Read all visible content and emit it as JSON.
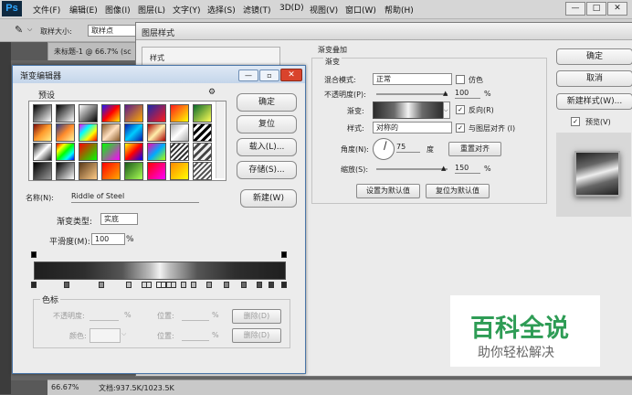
{
  "app": {
    "logo": "Ps",
    "menus": [
      "文件(F)",
      "编辑(E)",
      "图像(I)",
      "图层(L)",
      "文字(Y)",
      "选择(S)",
      "滤镜(T)",
      "3D(D)",
      "视图(V)",
      "窗口(W)",
      "帮助(H)"
    ],
    "window_controls": [
      "—",
      "□",
      "✕"
    ]
  },
  "options_bar": {
    "sample_size_label": "取样大小:",
    "sample_size_value": "取样点"
  },
  "document": {
    "tab_title": "未标题-1 @ 66.7% (sc",
    "zoom": "66.67%",
    "doc_info": "文档:937.5K/1023.5K"
  },
  "layer_style": {
    "title": "图层样式",
    "style_section": "样式",
    "group_title": "渐变叠加",
    "subgroup_title": "渐变",
    "blend_mode_label": "混合模式:",
    "blend_mode_value": "正常",
    "dither_label": "仿色",
    "opacity_label": "不透明度(P):",
    "opacity_value": "100",
    "opacity_unit": "%",
    "gradient_label": "渐变:",
    "reverse_label": "反向(R)",
    "style_label": "样式:",
    "style_value": "对称的",
    "align_label": "与图层对齐 (I)",
    "angle_label": "角度(N):",
    "angle_value": "75",
    "angle_unit": "度",
    "reset_align_button": "重置对齐",
    "scale_label": "缩放(S):",
    "scale_value": "150",
    "scale_unit": "%",
    "set_default_button": "设置为默认值",
    "reset_default_button": "复位为默认值",
    "ok_button": "确定",
    "cancel_button": "取消",
    "new_style_button": "新建样式(W)...",
    "preview_label": "预览(V)"
  },
  "gradient_editor": {
    "title": "渐变编辑器",
    "presets_label": "预设",
    "ok_button": "确定",
    "reset_button": "复位",
    "load_button": "载入(L)...",
    "save_button": "存储(S)...",
    "name_label": "名称(N):",
    "name_value": "Riddle of Steel",
    "new_button": "新建(W)",
    "gradient_type_label": "渐变类型:",
    "gradient_type_value": "实底",
    "smoothness_label": "平滑度(M):",
    "smoothness_value": "100",
    "smoothness_unit": "%",
    "stops_section": "色标",
    "stop_opacity_label": "不透明度:",
    "stop_opacity_unit": "%",
    "stop_location_label": "位置:",
    "stop_location_unit": "%",
    "stop_color_label": "颜色:",
    "delete_button": "删除(D)",
    "presets": [
      "linear-gradient(135deg,#000,#fff)",
      "linear-gradient(135deg,#000,rgba(0,0,0,0))",
      "linear-gradient(135deg,#fff,#000)",
      "linear-gradient(135deg,#1a1aff,#ff0000,#ffee00)",
      "linear-gradient(135deg,#5a1a8a,#ffaa00)",
      "linear-gradient(135deg,#1a2aaa,#ff1a1a)",
      "linear-gradient(135deg,#ff1a1a,#ffff00)",
      "linear-gradient(135deg,#0a6a2a,#ffff55)",
      "linear-gradient(135deg,#7a0a0a,#ff9a2a,#ffee88)",
      "linear-gradient(135deg,#2a3a8a,#ff8a2a,#fff7a0)",
      "linear-gradient(135deg,#ff00ff,#00ffff,#ffff00,#ff0000)",
      "linear-gradient(135deg,#8a5a2a,#ffe0c0,#8a5a2a)",
      "linear-gradient(135deg,#0a1aaa,#00ccff,#0a1aaa)",
      "linear-gradient(135deg,#aa0000,#ffeeaa,#aa0000)",
      "linear-gradient(135deg,#aaaaaa,#ffffff,#aaaaaa)",
      "repeating-linear-gradient(135deg,#000 0 3px,#fff 3px 6px)",
      "linear-gradient(135deg,#111,#fff,#111)",
      "linear-gradient(135deg,#ff0000,#ffff00,#00ff00,#00ffff,#0000ff)",
      "linear-gradient(135deg,#ff0000,#00ff00)",
      "linear-gradient(135deg,#00ff00,#ff00ff)",
      "linear-gradient(135deg,#ffff00,#ff0000,#0000ff)",
      "linear-gradient(135deg,#ff00aa,#00aaff,#aaff00)",
      "repeating-linear-gradient(135deg,#fff 0 2px,#333 2px 4px)",
      "repeating-linear-gradient(135deg,#eee 0 3px,#444 3px 6px)",
      "linear-gradient(135deg,#000,#999)",
      "linear-gradient(135deg,#000,#fff)",
      "linear-gradient(135deg,#5a3a1a,#ffcc88)",
      "linear-gradient(135deg,#ff0000,#ffaa00)",
      "linear-gradient(135deg,#1a5a1a,#aaff55)",
      "linear-gradient(135deg,#ff0000,#ff00ff)",
      "linear-gradient(135deg,#ff8800,#ffff00)",
      "repeating-linear-gradient(135deg,#fff 0 2px,#555 2px 4px)"
    ],
    "opacity_stops_count": 2,
    "color_stops": [
      0,
      0.13,
      0.27,
      0.38,
      0.44,
      0.46,
      0.5,
      0.52,
      0.54,
      0.56,
      0.6,
      0.64,
      0.7,
      0.77,
      0.84,
      0.9,
      0.95,
      1
    ]
  },
  "watermark": {
    "main_text": "百科全说",
    "sub_text": "助你轻松解决"
  }
}
